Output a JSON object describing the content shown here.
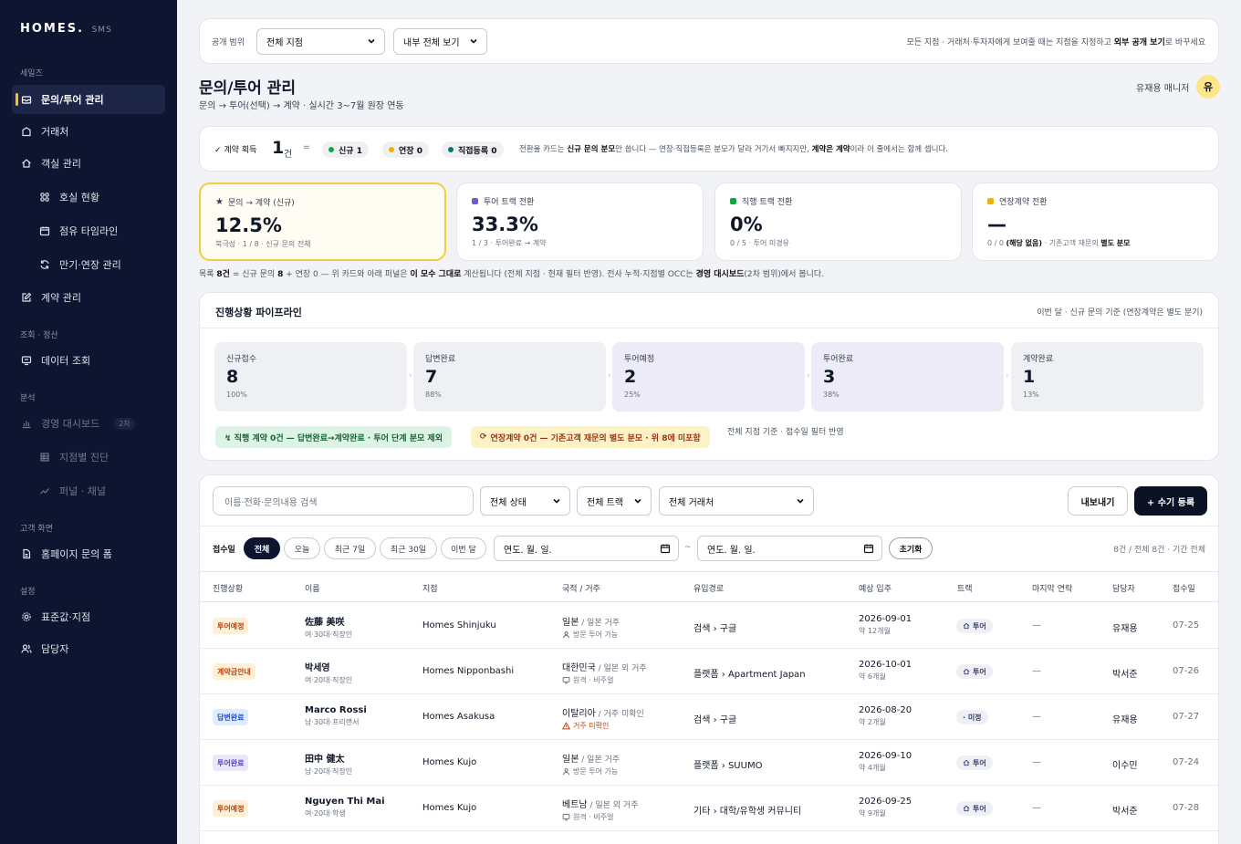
{
  "brand": {
    "name": "HOMES.",
    "suffix": "SMS"
  },
  "sidebar": {
    "sections": [
      "세일즈",
      "조회 · 정산",
      "분석",
      "고객 화면",
      "설정"
    ],
    "items": [
      {
        "label": "문의/투어 관리",
        "icon": "inbox-icon"
      },
      {
        "label": "거래처",
        "icon": "building-icon"
      },
      {
        "label": "객실 관리",
        "icon": "home-icon"
      },
      {
        "label": "호실 현황",
        "icon": "grid-icon"
      },
      {
        "label": "점유 타임라인",
        "icon": "calendar-icon"
      },
      {
        "label": "만기·연장 관리",
        "icon": "refresh-icon"
      },
      {
        "label": "계약 관리",
        "icon": "edit-icon"
      },
      {
        "label": "데이터 조회",
        "icon": "monitor-icon"
      },
      {
        "label": "경영 대시보드",
        "icon": "bar-chart-icon",
        "badge": "2차"
      },
      {
        "label": "지점별 진단",
        "icon": "table-icon"
      },
      {
        "label": "퍼널 · 채널",
        "icon": "trend-icon"
      },
      {
        "label": "홈페이지 문의 폼",
        "icon": "document-icon"
      },
      {
        "label": "표준값·지점",
        "icon": "gear-icon"
      },
      {
        "label": "담당자",
        "icon": "users-icon"
      }
    ]
  },
  "scope": {
    "label": "공개 범위",
    "branch_select": "전체 지점",
    "view_select": "내부 전체 보기",
    "hint_prefix": "모든 지점 · 거래처·투자자에게 보여줄 때는 지점을 지정하고 ",
    "hint_bold": "외부 공개 보기",
    "hint_suffix": "로 바꾸세요"
  },
  "header": {
    "title": "문의/투어 관리",
    "subtitle": "문의 → 투어(선택) → 계약 · 실시간 3~7월 원장 연동",
    "manager": "유재용 매니저",
    "avatar": "유"
  },
  "summary": {
    "label": "✓ 계약 획득",
    "count": "1",
    "unit": "건",
    "equals": "=",
    "pills": [
      {
        "label": "신규 1",
        "color": "#16a34a"
      },
      {
        "label": "연장 0",
        "color": "#eab308"
      },
      {
        "label": "직접등록 0",
        "color": "#0f766e"
      }
    ],
    "note_a": "전환율 카드는 ",
    "note_b": "신규 문의 분모",
    "note_c": "만 씁니다 — 연장·직접등록은 분모가 달라 거기서 빠지지만, ",
    "note_d": "계약은 계약",
    "note_e": "이라 이 줄에서는 함께 셉니다."
  },
  "metrics": [
    {
      "title": "문의 → 계약 (신규)",
      "value": "12.5%",
      "sub": "북극성 · 1 / 8 · 신규 문의 전체",
      "color": "#111827"
    },
    {
      "title": "투어 트랙 전환",
      "value": "33.3%",
      "sub": "1 / 3 · 투어완료 → 계약",
      "color": "#6d5dd3"
    },
    {
      "title": "직행 트랙 전환",
      "value": "0%",
      "sub": "0 / 5 · 투어 미경유",
      "color": "#16a34a"
    },
    {
      "title": "연장계약 전환",
      "value": "—",
      "sub_a": "0 / 0 ",
      "sub_b": "(해당 없음)",
      "sub_c": " · 기존고객 재문의 ",
      "sub_d": "별도 분모",
      "color": "#eab308"
    }
  ],
  "note": {
    "a": "목록 ",
    "b": "8건",
    "c": " = 신규 문의 ",
    "d": "8",
    "e": " + 연장 0 — 위 카드와 아래 퍼널은 ",
    "f": "이 모수 그대로",
    "g": " 계산됩니다 (전체 지점 · 현재 필터 반영). 전사 누적·지점별 OCC는 ",
    "h": "경영 대시보드",
    "i": "(2차 범위)에서 봅니다."
  },
  "pipeline": {
    "title": "진행상황 파이프라인",
    "caption": "이번 달 · 신규 문의 기준 (연장계약은 별도 분기)",
    "stages": [
      {
        "label": "신규접수",
        "value": "8",
        "pct": "100%"
      },
      {
        "label": "답변완료",
        "value": "7",
        "pct": "88%"
      },
      {
        "label": "투어예정",
        "value": "2",
        "pct": "25%"
      },
      {
        "label": "투어완료",
        "value": "3",
        "pct": "38%"
      },
      {
        "label": "계약완료",
        "value": "1",
        "pct": "13%"
      }
    ],
    "banner_green": "↯ 직행 계약 0건 — 답변완료→계약완료 · 투어 단계 분모 제외",
    "banner_yellow": "연장계약 0건 — 기존고객 재문의 별도 분모 · 위 8에 미포함",
    "banner_note": "전체 지점 기준 · 접수일 필터 반영"
  },
  "list": {
    "search_placeholder": "이름·전화·문의내용 검색",
    "filters": [
      "전체 상태",
      "전체 트랙",
      "전체 거래처"
    ],
    "export_label": "내보내기",
    "add_label": "+ 수기 등록",
    "date_label": "접수일",
    "chips": [
      "전체",
      "오늘",
      "최근 7일",
      "최근 30일",
      "이번 달"
    ],
    "date_from": "연도. 월. 일.",
    "date_to": "연도. 월. 일.",
    "date_sep": "~",
    "reset_label": "초기화",
    "count_text": "8건 / 전체 8건 · 기간 전체",
    "columns": [
      "진행상황",
      "이름",
      "지점",
      "국적 / 거주",
      "유입경로",
      "예상 입주",
      "트랙",
      "마지막 연락",
      "담당자",
      "접수일"
    ],
    "rows": [
      {
        "status": "투어예정",
        "status_type": "orange",
        "name": "佐藤 美咲",
        "profile": "여·30대·직장인",
        "branch": "Homes Shinjuku",
        "nation": "일본",
        "residence": " / 일본 거주",
        "mode": "방문 투어 가능",
        "mode_icon": "person-icon",
        "source": "검색 › 구글",
        "date": "2026-09-01",
        "period": "약 12개월",
        "track": "투어",
        "last": "—",
        "manager": "유재용",
        "received": "07-25"
      },
      {
        "status": "계약금안내",
        "status_type": "orange",
        "name": "박세영",
        "profile": "여·20대·직장인",
        "branch": "Homes Nipponbashi",
        "nation": "대한민국",
        "residence": " / 일본 외 거주",
        "mode": "원격 · 비주얼",
        "mode_icon": "monitor-icon",
        "source": "플랫폼 › Apartment Japan",
        "date": "2026-10-01",
        "period": "약 6개월",
        "track": "투어",
        "last": "—",
        "manager": "박서준",
        "received": "07-26"
      },
      {
        "status": "답변완료",
        "status_type": "blue",
        "name": "Marco Rossi",
        "profile": "남·30대·프리랜서",
        "branch": "Homes Asakusa",
        "nation": "이탈리아",
        "residence": " / 거주 미확인",
        "mode": "거주 미확인",
        "mode_icon": "warning-icon",
        "source": "검색 › 구글",
        "date": "2026-08-20",
        "period": "약 2개월",
        "track": "· 미정",
        "last": "—",
        "manager": "유재용",
        "received": "07-27"
      },
      {
        "status": "투어완료",
        "status_type": "purple",
        "name": "田中 健太",
        "profile": "남·20대·직장인",
        "branch": "Homes Kujo",
        "nation": "일본",
        "residence": " / 일본 거주",
        "mode": "방문 투어 가능",
        "mode_icon": "person-icon",
        "source": "플랫폼 › SUUMO",
        "date": "2026-09-10",
        "period": "약 4개월",
        "track": "투어",
        "last": "—",
        "manager": "이수민",
        "received": "07-24"
      },
      {
        "status": "투어예정",
        "status_type": "orange",
        "name": "Nguyen Thi Mai",
        "profile": "여·20대·학생",
        "branch": "Homes Kujo",
        "nation": "베트남",
        "residence": " / 일본 외 거주",
        "mode": "원격 · 비주얼",
        "mode_icon": "monitor-icon",
        "source": "기타 › 대학/유학생 커뮤니티",
        "date": "2026-09-25",
        "period": "약 9개월",
        "track": "투어",
        "last": "—",
        "manager": "박서준",
        "received": "07-28"
      }
    ]
  }
}
